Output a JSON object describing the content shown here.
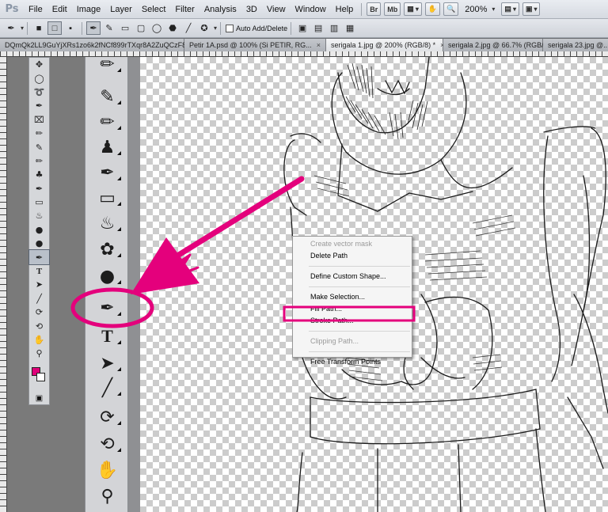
{
  "app": {
    "logo": "Ps",
    "menu": [
      "File",
      "Edit",
      "Image",
      "Layer",
      "Select",
      "Filter",
      "Analysis",
      "3D",
      "View",
      "Window",
      "Help"
    ],
    "bridge_label": "Br",
    "minibridge_label": "Mb",
    "zoom_level": "200%"
  },
  "options_bar": {
    "tool_icon": "pen-icon",
    "auto_add_delete_label": "Auto Add/Delete"
  },
  "tabs": [
    {
      "label": "DQmQk2LL9GuYjXRs1zo6k2fNCf899rTXqr8A2ZuQCzF8DU9.png",
      "active": false
    },
    {
      "label": "Petir 1A.psd @ 100% (Si PETIR, RG...",
      "active": false
    },
    {
      "label": "serigala 1.jpg @ 200% (RGB/8) *",
      "active": true
    },
    {
      "label": "serigala 2.jpg @ 66.7% (RGB/...",
      "active": false
    },
    {
      "label": "serigala 23.jpg @...",
      "active": false
    }
  ],
  "tools_small": [
    "move-icon",
    "marquee-icon",
    "lasso-icon",
    "quick-selection-icon",
    "crop-icon",
    "eyedropper-icon",
    "spot-healing-icon",
    "brush-icon",
    "clone-stamp-icon",
    "history-brush-icon",
    "eraser-icon",
    "paint-bucket-icon",
    "blur-icon",
    "dodge-icon",
    "pen-icon",
    "type-icon",
    "path-selection-icon",
    "line-icon",
    "3d-rotate-icon",
    "3d-camera-icon",
    "hand-icon",
    "zoom-icon"
  ],
  "colors": {
    "foreground": "#e0007a",
    "background": "#ffffff",
    "annotation": "#e4007c"
  },
  "context_menu": {
    "items": [
      {
        "label": "Create vector mask",
        "disabled": true
      },
      {
        "label": "Delete Path",
        "disabled": false
      },
      {
        "separator": true
      },
      {
        "label": "Define Custom Shape...",
        "disabled": false
      },
      {
        "separator": true
      },
      {
        "label": "Make Selection...",
        "disabled": false
      },
      {
        "label": "Fill Path...",
        "disabled": false
      },
      {
        "label": "Stroke Path...",
        "disabled": false,
        "highlighted": true
      },
      {
        "separator": true
      },
      {
        "label": "Clipping Path...",
        "disabled": true
      },
      {
        "separator": true
      },
      {
        "label": "Free Transform Points",
        "disabled": false
      }
    ]
  }
}
